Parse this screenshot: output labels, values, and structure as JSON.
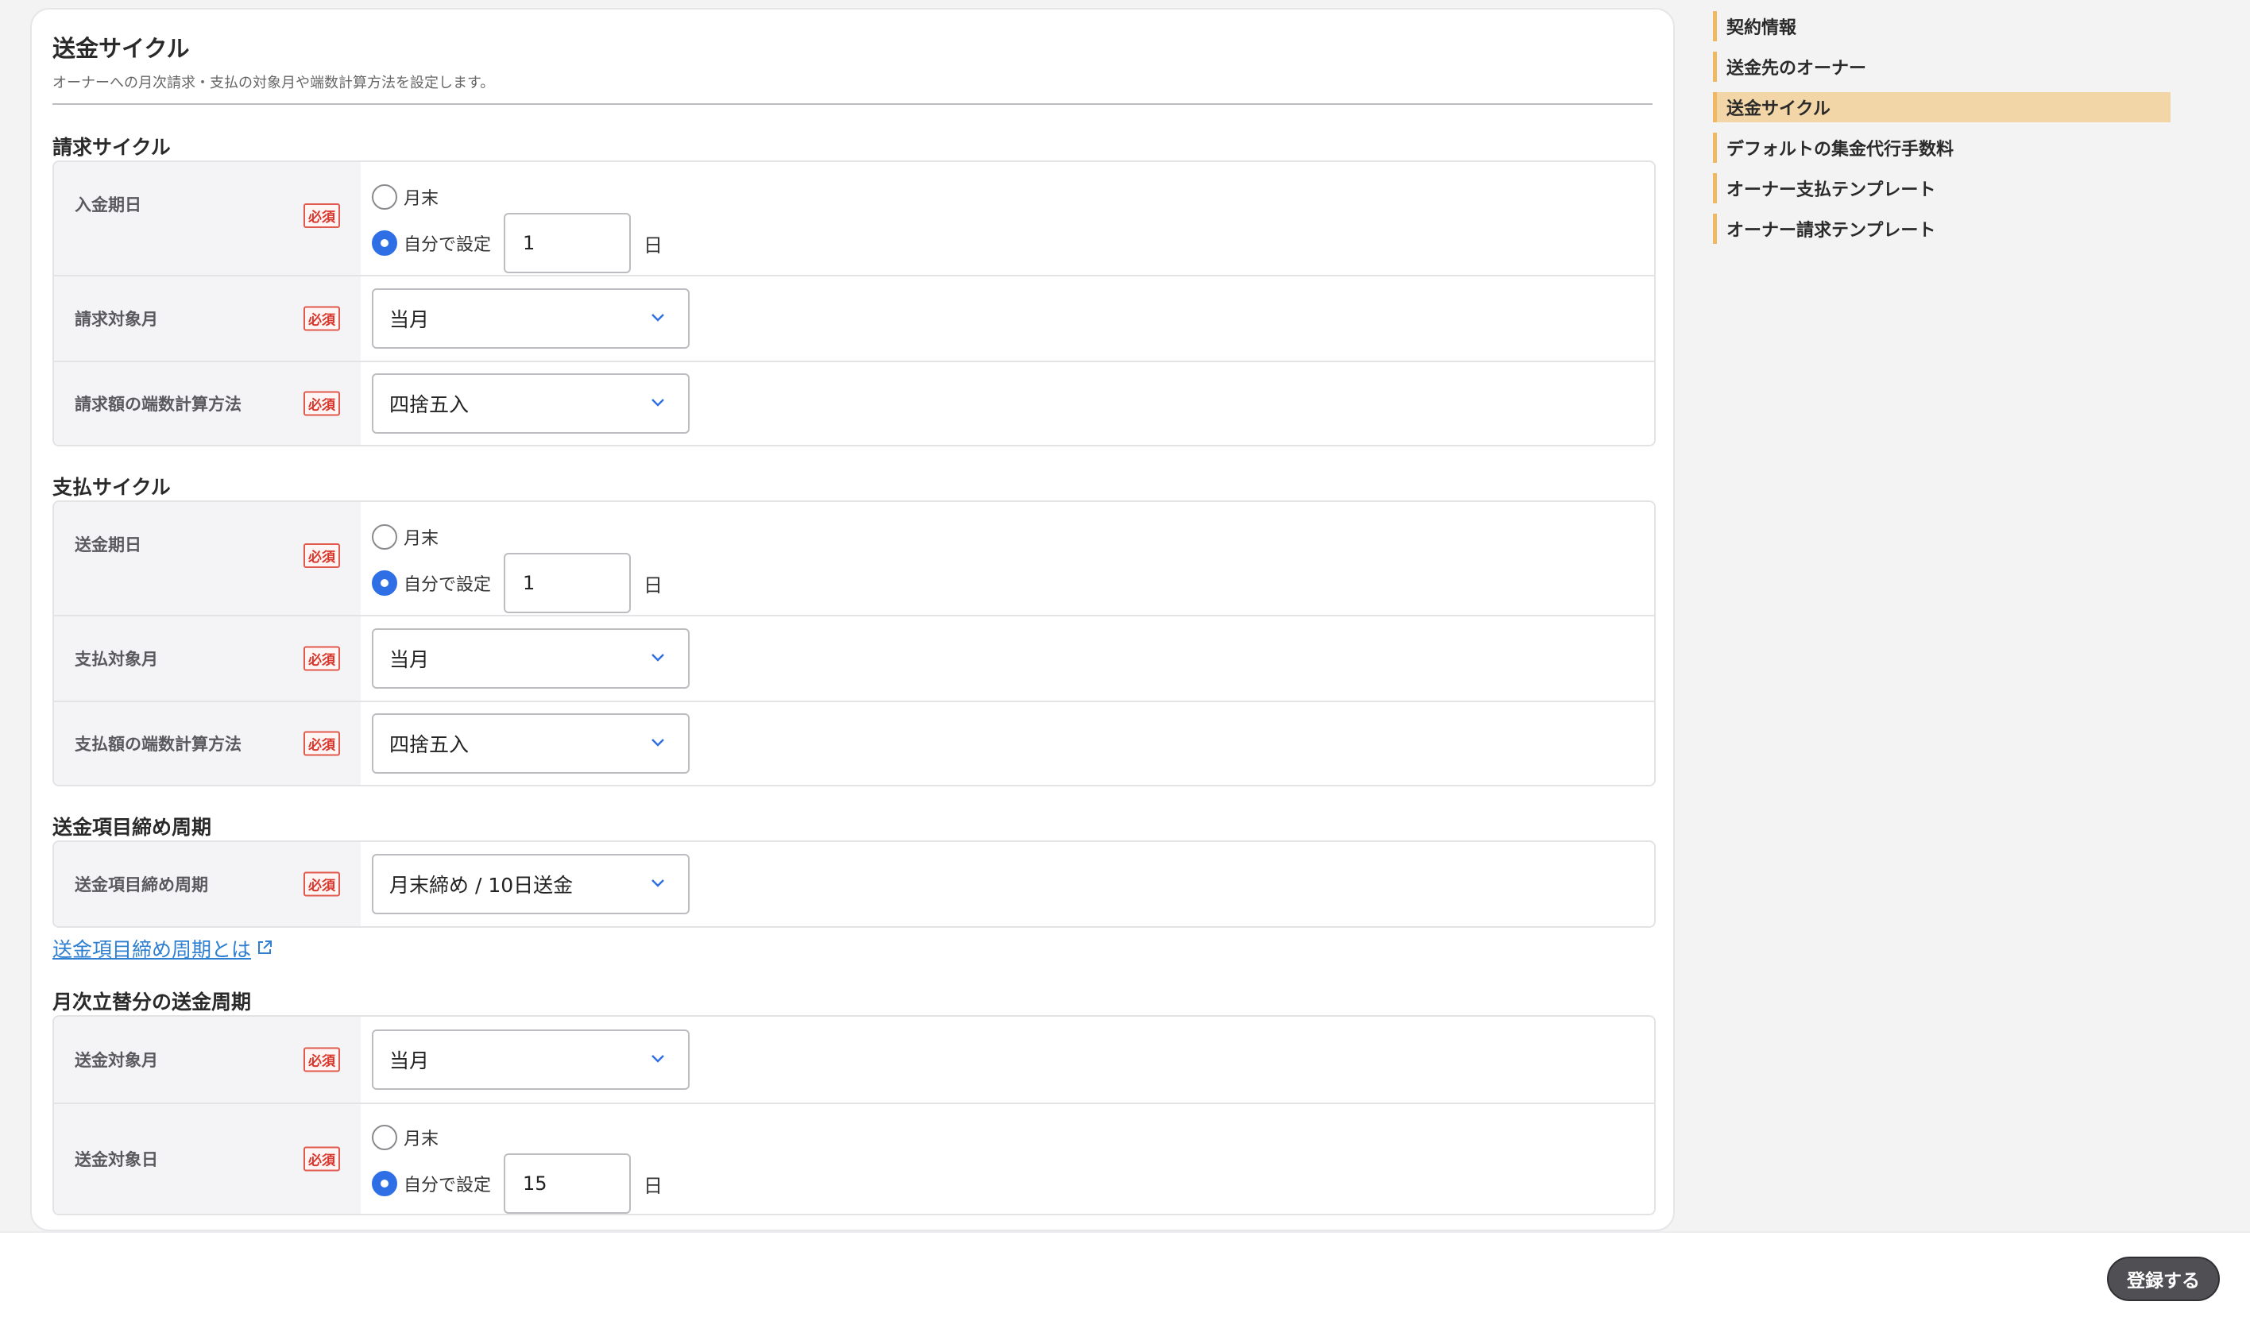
{
  "card": {
    "title": "送金サイクル",
    "description": "オーナーへの月次請求・支払の対象月や端数計算方法を設定します。"
  },
  "required_badge": "必須",
  "billing_cycle": {
    "title": "請求サイクル",
    "payment_day": {
      "label": "入金期日",
      "option_end": "月末",
      "option_custom": "自分で設定",
      "value": "1",
      "unit": "日",
      "selected": "custom"
    },
    "target_month": {
      "label": "請求対象月",
      "value": "当月"
    },
    "rounding": {
      "label": "請求額の端数計算方法",
      "value": "四捨五入"
    }
  },
  "payout_cycle": {
    "title": "支払サイクル",
    "transfer_day": {
      "label": "送金期日",
      "option_end": "月末",
      "option_custom": "自分で設定",
      "value": "1",
      "unit": "日",
      "selected": "custom"
    },
    "target_month": {
      "label": "支払対象月",
      "value": "当月"
    },
    "rounding": {
      "label": "支払額の端数計算方法",
      "value": "四捨五入"
    }
  },
  "closing_cycle": {
    "title": "送金項目締め周期",
    "field": {
      "label": "送金項目締め周期",
      "value": "月末締め / 10日送金"
    },
    "help_link": "送金項目締め周期とは"
  },
  "monthly_advance": {
    "title": "月次立替分の送金周期",
    "target_month": {
      "label": "送金対象月",
      "value": "当月"
    },
    "target_day": {
      "label": "送金対象日",
      "option_end": "月末",
      "option_custom": "自分で設定",
      "value": "15",
      "unit": "日",
      "selected": "custom"
    }
  },
  "side_nav": {
    "items": [
      {
        "label": "契約情報",
        "active": false
      },
      {
        "label": "送金先のオーナー",
        "active": false
      },
      {
        "label": "送金サイクル",
        "active": true
      },
      {
        "label": "デフォルトの集金代行手数料",
        "active": false
      },
      {
        "label": "オーナー支払テンプレート",
        "active": false
      },
      {
        "label": "オーナー請求テンプレート",
        "active": false
      }
    ]
  },
  "footer": {
    "submit_label": "登録する"
  },
  "colors": {
    "accent_blue": "#2f6fe6",
    "required_red": "#d9362b",
    "nav_marker": "#f0b860",
    "nav_active_bg": "#f3d6a8",
    "link": "#2f7fd0"
  }
}
